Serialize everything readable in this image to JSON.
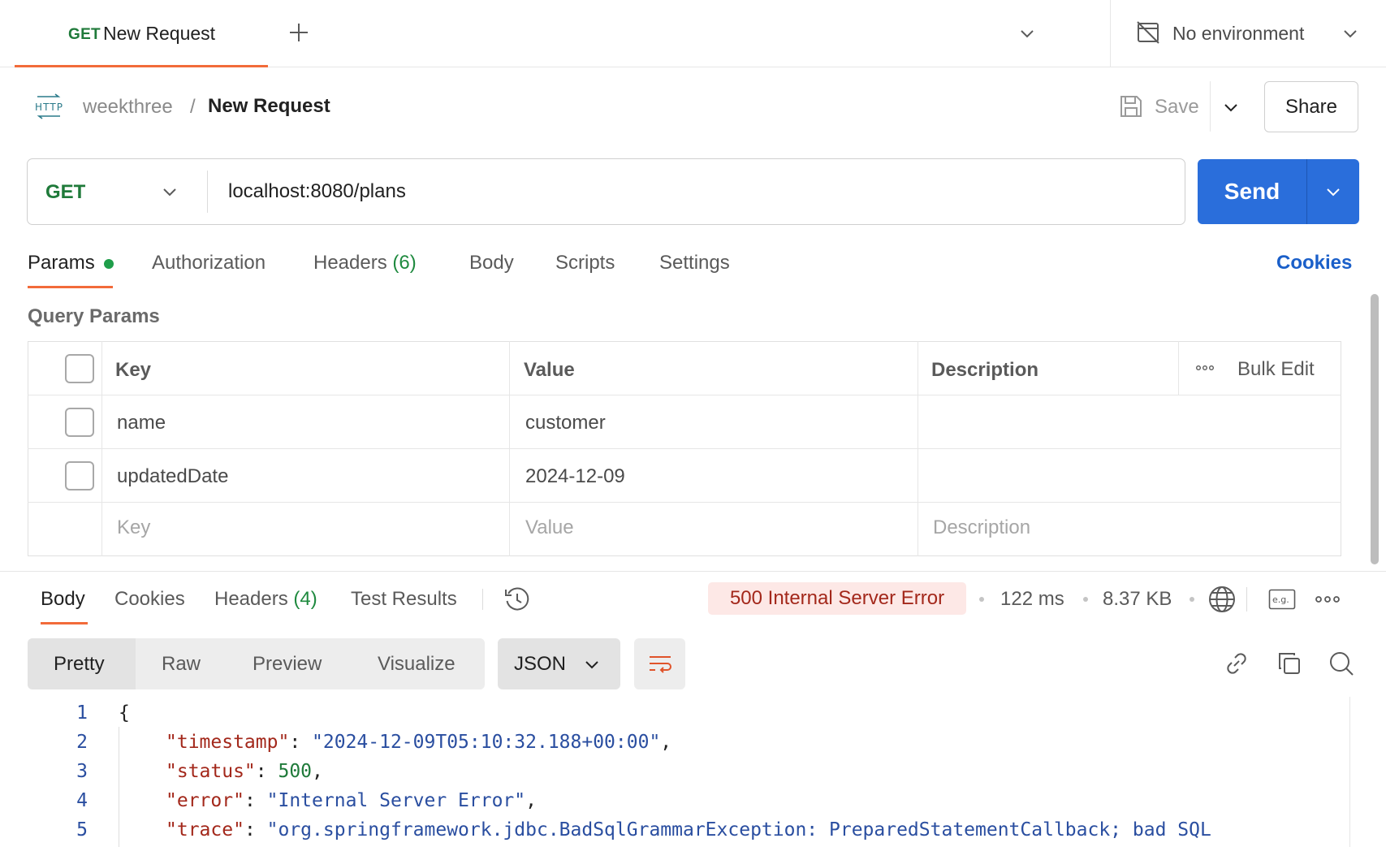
{
  "tab": {
    "method": "GET",
    "title": "New Request"
  },
  "environment": {
    "label": "No environment"
  },
  "breadcrumb": {
    "workspace": "weekthree",
    "separator": "/",
    "request_name": "New Request"
  },
  "actions": {
    "save_label": "Save",
    "share_label": "Share"
  },
  "request": {
    "method": "GET",
    "url": "localhost:8080/plans",
    "send_label": "Send"
  },
  "request_tabs": {
    "params": "Params",
    "authorization": "Authorization",
    "headers": "Headers",
    "headers_count": "(6)",
    "body": "Body",
    "scripts": "Scripts",
    "settings": "Settings",
    "cookies": "Cookies"
  },
  "query_params": {
    "title": "Query Params",
    "columns": {
      "key": "Key",
      "value": "Value",
      "description": "Description"
    },
    "bulk_edit": "Bulk Edit",
    "rows": [
      {
        "key": "name",
        "value": "customer",
        "description": ""
      },
      {
        "key": "updatedDate",
        "value": "2024-12-09",
        "description": ""
      }
    ],
    "placeholders": {
      "key": "Key",
      "value": "Value",
      "description": "Description"
    }
  },
  "response_tabs": {
    "body": "Body",
    "cookies": "Cookies",
    "headers": "Headers",
    "headers_count": "(4)",
    "test_results": "Test Results"
  },
  "response_meta": {
    "status": "500 Internal Server Error",
    "time": "122 ms",
    "size": "8.37 KB",
    "status_color": "#a3281b",
    "status_bg": "#fde8e6"
  },
  "viewer": {
    "modes": [
      "Pretty",
      "Raw",
      "Preview",
      "Visualize"
    ],
    "format": "JSON"
  },
  "code": {
    "line_numbers": [
      "1",
      "2",
      "3",
      "4",
      "5"
    ],
    "open_brace": "{",
    "colon": ": ",
    "comma": ",",
    "lines": [
      {
        "key": "\"timestamp\"",
        "value": "\"2024-12-09T05:10:32.188+00:00\""
      },
      {
        "key": "\"status\"",
        "value": "500"
      },
      {
        "key": "\"error\"",
        "value": "\"Internal Server Error\""
      },
      {
        "key": "\"trace\"",
        "value": "\"org.springframework.jdbc.BadSqlGrammarException: PreparedStatementCallback; bad SQL"
      }
    ]
  },
  "colors": {
    "accent": "#f26b3a",
    "send": "#2a6edb",
    "method_get": "#1f7a3a",
    "link": "#1a5fc9"
  },
  "icons": [
    "plus-icon",
    "chevron-down-icon",
    "no-environment-icon",
    "http-icon",
    "save-icon",
    "history-icon",
    "globe-icon",
    "example-icon",
    "more-icon",
    "wrap-lines-icon",
    "link-icon",
    "copy-icon",
    "search-icon"
  ]
}
